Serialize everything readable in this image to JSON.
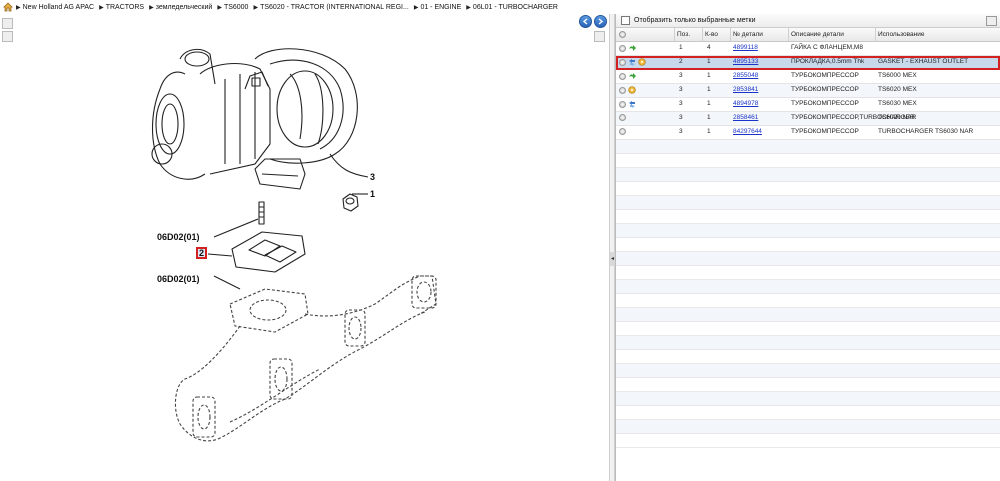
{
  "breadcrumb": [
    "New Holland AG APAC",
    "TRACTORS",
    "земледельческий",
    "TS6000",
    "TS6020 - TRACTOR (INTERNATIONAL REGI...",
    "01 - ENGINE",
    "06L01 - TURBOCHARGER"
  ],
  "diagram": {
    "callouts": {
      "c3": "3",
      "c1": "1",
      "ref_top": "06D02(01)",
      "c2": "2",
      "ref_bottom": "06D02(01)"
    }
  },
  "filter": {
    "label": "Отобразить только выбранные метки"
  },
  "columns": {
    "pos": "Поз.",
    "qty": "К-во",
    "part_no": "№ детали",
    "desc": "Описание детали",
    "usage": "Использование"
  },
  "rows": [
    {
      "pos": "1",
      "qty": "4",
      "part_no": "4899118",
      "desc": "ГАЙКА С ФЛАНЦЕМ,M8",
      "usage": "",
      "icons": [
        "info-icon",
        "green-arrow-icon"
      ]
    },
    {
      "pos": "2",
      "qty": "1",
      "part_no": "4895133",
      "desc": "ПРОКЛАДКА,0.5mm Thk",
      "usage": "GASKET - EXHAUST OUTLET",
      "icons": [
        "info-icon",
        "blue-swap-icon",
        "gear-coin-icon"
      ],
      "selected": true
    },
    {
      "pos": "3",
      "qty": "1",
      "part_no": "2855048",
      "desc": "ТУРБОКОМПРЕССОР",
      "usage": "TS6000 MEX",
      "icons": [
        "info-icon",
        "green-arrow-icon"
      ]
    },
    {
      "pos": "3",
      "qty": "1",
      "part_no": "2853841",
      "desc": "ТУРБОКОМПРЕССОР",
      "usage": "TS6020 MEX",
      "icons": [
        "info-icon",
        "gear-coin-icon"
      ]
    },
    {
      "pos": "3",
      "qty": "1",
      "part_no": "4894978",
      "desc": "ТУРБОКОМПРЕССОР",
      "usage": "TS6030 MEX",
      "icons": [
        "info-icon",
        "blue-swap-icon"
      ]
    },
    {
      "pos": "3",
      "qty": "1",
      "part_no": "2858461",
      "desc": "ТУРБОКОМПРЕССОР,TURBOCHARGER",
      "usage": "TS6020 NAR",
      "icons": [
        "info-icon"
      ]
    },
    {
      "pos": "3",
      "qty": "1",
      "part_no": "84297644",
      "desc": "ТУРБОКОМПРЕССОР",
      "usage": "TURBOCHARGER TS6030 NAR",
      "icons": [
        "info-icon"
      ]
    }
  ],
  "colors": {
    "selection_outline": "#d32020",
    "link": "#1a33c8",
    "nav_button": "#2a63b8"
  }
}
